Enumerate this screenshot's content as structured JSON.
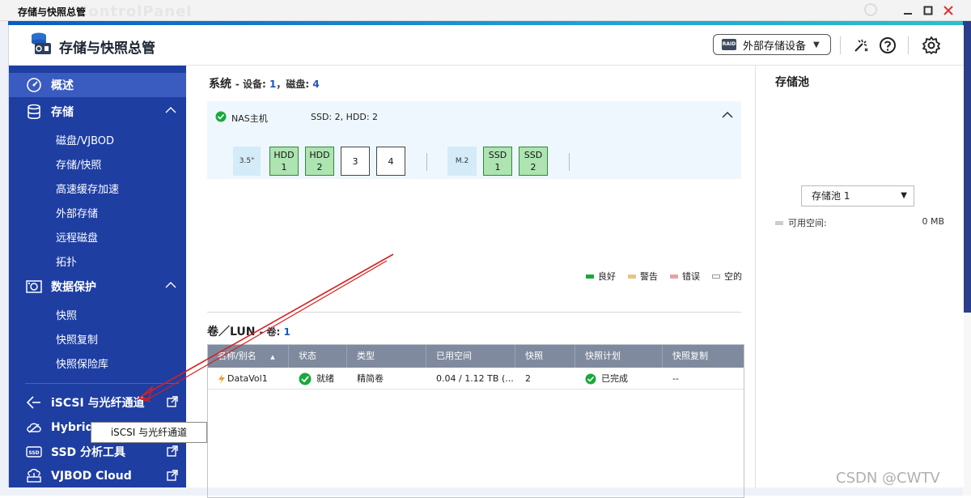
{
  "titlebar": {
    "title": "存储与快照总管",
    "ghost_text": "ControlPanel"
  },
  "header": {
    "app_title": "存储与快照总管",
    "external_button": "外部存储设备",
    "raid_badge": "RAID"
  },
  "sidebar": {
    "overview": "概述",
    "storage": "存储",
    "storage_items": [
      "磁盘/VJBOD",
      "存储/快照",
      "高速缓存加速",
      "外部存储",
      "远程磁盘",
      "拓扑"
    ],
    "protection": "数据保护",
    "protection_items": [
      "快照",
      "快照复制",
      "快照保险库"
    ],
    "iscsi": "iSCSI 与光纤通道",
    "hybridmount": "HybridMount",
    "ssd_tool": "SSD 分析工具",
    "vjbod_cloud": "VJBOD Cloud",
    "ssd_badge": "SSD"
  },
  "system": {
    "title": "系统",
    "meta_prefix": "- 设备: ",
    "device_count": "1",
    "meta_mid": "，磁盘: ",
    "disk_count": "4",
    "nas_name": "NAS主机",
    "nas_disks": "SSD: 2, HDD: 2",
    "slot_35": "3.5\"",
    "slot_m2": "M.2",
    "slots": [
      {
        "type": "HDD",
        "num": "1"
      },
      {
        "type": "HDD",
        "num": "2"
      },
      {
        "type": "",
        "num": "3"
      },
      {
        "type": "",
        "num": "4"
      }
    ],
    "ssd_slots": [
      {
        "type": "SSD",
        "num": "1"
      },
      {
        "type": "SSD",
        "num": "2"
      }
    ]
  },
  "legend": {
    "good": "良好",
    "warning": "警告",
    "error": "错误",
    "empty": "空的",
    "colors": {
      "good": "#1aa83a",
      "warning": "#e8c48a",
      "error": "#e8a0a8",
      "empty": "#ffffff"
    }
  },
  "volumes": {
    "title": "卷／LUN",
    "meta_prefix": "- 卷: ",
    "count": "1",
    "columns": [
      "名称/别名",
      "状态",
      "类型",
      "已用空间",
      "快照",
      "快照计划",
      "快照复制"
    ],
    "rows": [
      {
        "name": "DataVol1",
        "status": "就绪",
        "type": "精简卷",
        "used": "0.04 / 1.12 TB (...",
        "snapshots": "2",
        "schedule": "已完成",
        "replication": "--"
      }
    ]
  },
  "pool": {
    "title": "存储池",
    "selected": "存储池 1",
    "available_label": "可用空间:",
    "available_value": "0 MB"
  },
  "tooltip": "iSCSI 与光纤通道",
  "watermark": "CSDN @CWTV",
  "colors": {
    "sidebar_bg": "#1e3ea2",
    "accent": "#1e58b8",
    "table_header": "#7f8a9e"
  }
}
